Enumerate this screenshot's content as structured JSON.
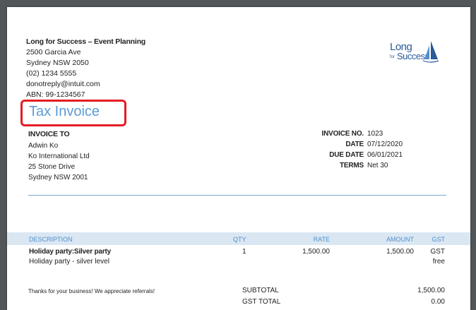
{
  "company": {
    "name": "Long for Success –  Event Planning",
    "address1": "2500 Garcia Ave",
    "address2": "Sydney NSW  2050",
    "phone": "(02) 1234 5555",
    "email": "donotreply@intuit.com",
    "abn": "ABN: 99-1234567"
  },
  "logo": {
    "line1": "Long",
    "small": "for",
    "line2": "Success",
    "accent": "#2a5a99"
  },
  "document_title": "Tax Invoice",
  "colors": {
    "title": "#5b9bd5",
    "highlight": "#e31c23",
    "table_header_bg": "#dae7f3",
    "table_header_text": "#4f8fcf"
  },
  "invoice_to": {
    "label": "INVOICE TO",
    "name": "Adwin Ko",
    "company": "Ko International Ltd",
    "street": "25 Stone Drive",
    "city": "Sydney NSW  2001"
  },
  "meta": {
    "invoice_no_label": "INVOICE NO.",
    "invoice_no": "1023",
    "date_label": "DATE",
    "date": "07/12/2020",
    "due_date_label": "DUE DATE",
    "due_date": "06/01/2021",
    "terms_label": "TERMS",
    "terms": "Net 30"
  },
  "table": {
    "headers": {
      "description": "DESCRIPTION",
      "qty": "QTY",
      "rate": "RATE",
      "amount": "AMOUNT",
      "gst": "GST"
    },
    "rows": [
      {
        "item": "Holiday party:Silver party",
        "detail": "Holiday party - silver level",
        "qty": "1",
        "rate": "1,500.00",
        "amount": "1,500.00",
        "gst_line1": "GST",
        "gst_line2": "free"
      }
    ]
  },
  "footer": {
    "thanks": "Thanks for your business!  We appreciate referrals!",
    "subtotal_label": "SUBTOTAL",
    "subtotal": "1,500.00",
    "gst_total_label": "GST TOTAL",
    "gst_total": "0.00"
  }
}
